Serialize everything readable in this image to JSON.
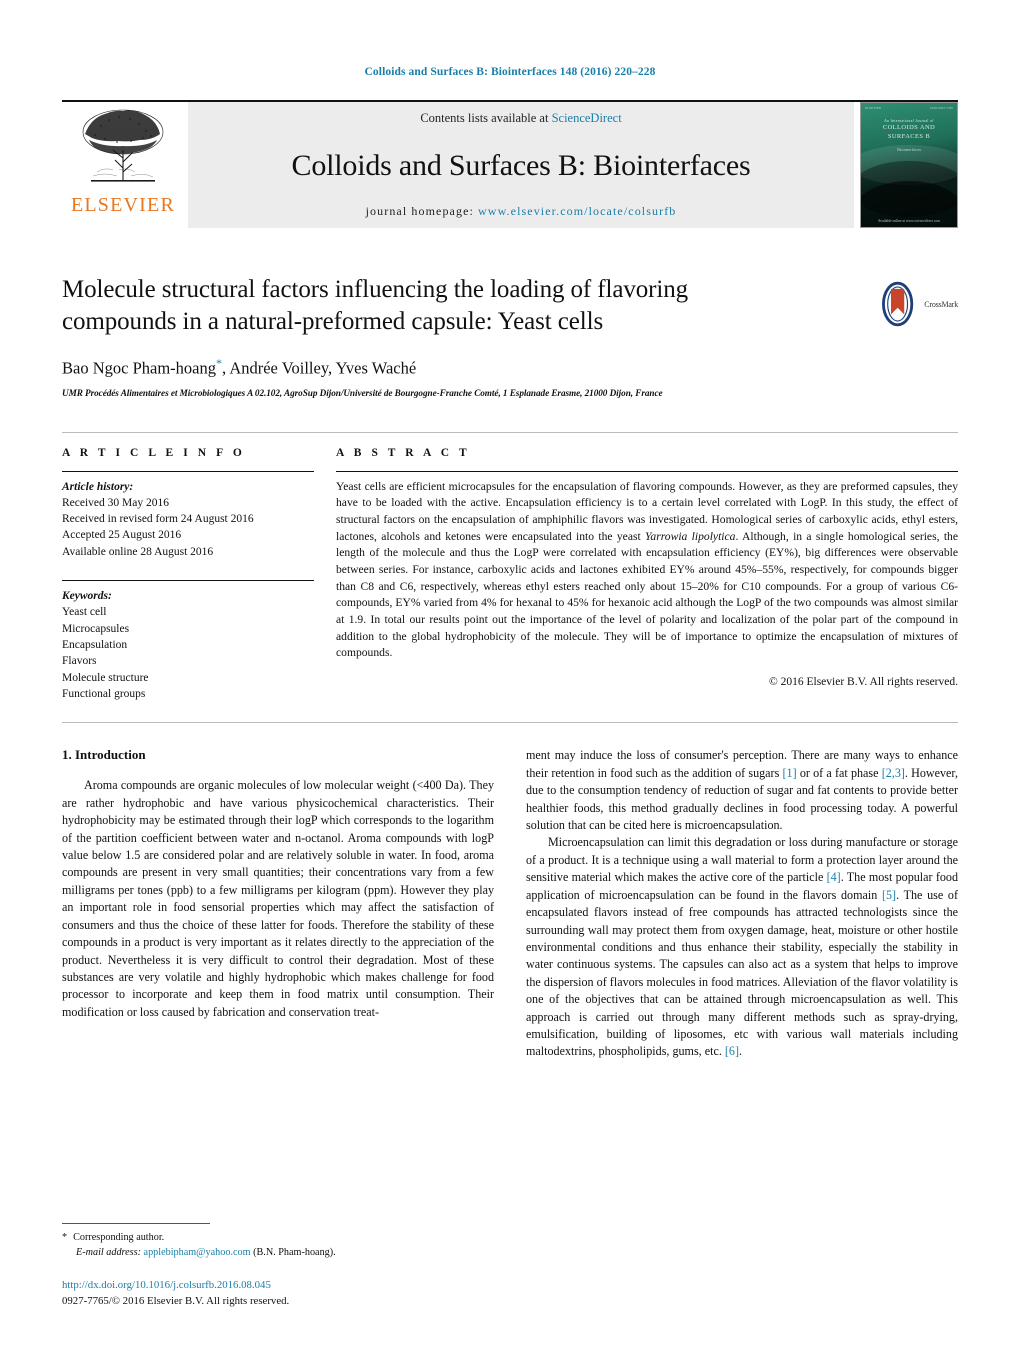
{
  "running_head": "Colloids and Surfaces B: Biointerfaces 148 (2016) 220–228",
  "masthead": {
    "contents_prefix": "Contents lists available at ",
    "sciencedirect": "ScienceDirect",
    "journal_title": "Colloids and Surfaces B: Biointerfaces",
    "homepage_prefix": "journal homepage: ",
    "homepage_url": "www.elsevier.com/locate/colsurfb",
    "publisher": "ELSEVIER",
    "cover": {
      "top_left": "ELSEVIER",
      "top_right": "ISSN 0927-7765",
      "eyebrow": "An International Journal of",
      "title_line1": "COLLOIDS AND",
      "title_line2": "SURFACES B",
      "subtitle": "Biointerfaces",
      "bottom": "Available online at www.sciencedirect.com"
    }
  },
  "article": {
    "title": "Molecule structural factors influencing the loading of flavoring compounds in a natural-preformed capsule: Yeast cells",
    "crossmark_label": "CrossMark",
    "authors": "Bao Ngoc Pham-hoang",
    "authors_rest": ", Andrée Voilley, Yves Waché",
    "corresponding_marker": "*",
    "affiliation": "UMR Procédés Alimentaires et Microbiologiques A 02.102, AgroSup Dijon/Université de Bourgogne-Franche Comté, 1 Esplanade Erasme, 21000 Dijon, France"
  },
  "article_info": {
    "heading": "A R T I C L E   I N F O",
    "history_label": "Article history:",
    "history": [
      "Received 30 May 2016",
      "Received in revised form 24 August 2016",
      "Accepted 25 August 2016",
      "Available online 28 August 2016"
    ],
    "keywords_label": "Keywords:",
    "keywords": [
      "Yeast cell",
      "Microcapsules",
      "Encapsulation",
      "Flavors",
      "Molecule structure",
      "Functional groups"
    ]
  },
  "abstract": {
    "heading": "A B S T R A C T",
    "part1": "Yeast cells are efficient microcapsules for the encapsulation of flavoring compounds. However, as they are preformed capsules, they have to be loaded with the active. Encapsulation efficiency is to a certain level correlated with LogP. In this study, the effect of structural factors on the encapsulation of amphiphilic flavors was investigated. Homological series of carboxylic acids, ethyl esters, lactones, alcohols and ketones were encapsulated into the yeast ",
    "italic_organism": "Yarrowia lipolytica",
    "part2": ". Although, in a single homological series, the length of the molecule and thus the LogP were correlated with encapsulation efficiency (EY%), big differences were observable between series. For instance, carboxylic acids and lactones exhibited EY% around 45%–55%, respectively, for compounds bigger than C8 and C6, respectively, whereas ethyl esters reached only about 15–20% for C10 compounds. For a group of various C6-compounds, EY% varied from 4% for hexanal to 45% for hexanoic acid although the LogP of the two compounds was almost similar at 1.9. In total our results point out the importance of the level of polarity and localization of the polar part of the compound in addition to the global hydrophobicity of the molecule. They will be of importance to optimize the encapsulation of mixtures of compounds.",
    "copyright": "© 2016 Elsevier B.V. All rights reserved."
  },
  "body": {
    "section_heading": "1. Introduction",
    "left_paragraph_1": "Aroma compounds are organic molecules of low molecular weight (<400 Da). They are rather hydrophobic and have various physicochemical characteristics. Their hydrophobicity may be estimated through their logP which corresponds to the logarithm of the partition coefficient between water and n-octanol. Aroma compounds with logP value below 1.5 are considered polar and are relatively soluble in water. In food, aroma compounds are present in very small quantities; their concentrations vary from a few milligrams per tones (ppb) to a few milligrams per kilogram (ppm). However they play an important role in food sensorial properties which may affect the satisfaction of consumers and thus the choice of these latter for foods. Therefore the stability of these compounds in a product is very important as it relates directly to the appreciation of the product. Nevertheless it is very difficult to control their degradation. Most of these substances are very volatile and highly hydrophobic which makes challenge for food processor to incorporate and keep them in food matrix until consumption. Their modification or loss caused by fabrication and conservation treat-",
    "right_paragraph_1a": "ment may induce the loss of consumer's perception. There are many ways to enhance their retention in food such as the addition of sugars ",
    "right_ref_1": "[1]",
    "right_paragraph_1b": " or of a fat phase ",
    "right_ref_23": "[2,3]",
    "right_paragraph_1c": ". However, due to the consumption tendency of reduction of sugar and fat contents to provide better healthier foods, this method gradually declines in food processing today. A powerful solution that can be cited here is microencapsulation.",
    "right_paragraph_2a": "Microencapsulation can limit this degradation or loss during manufacture or storage of a product. It is a technique using a wall material to form a protection layer around the sensitive material which makes the active core of the particle ",
    "right_ref_4": "[4]",
    "right_paragraph_2b": ". The most popular food application of microencapsulation can be found in the flavors domain ",
    "right_ref_5": "[5]",
    "right_paragraph_2c": ". The use of encapsulated flavors instead of free compounds has attracted technologists since the surrounding wall may protect them from oxygen damage, heat, moisture or other hostile environmental conditions and thus enhance their stability, especially the stability in water continuous systems. The capsules can also act as a system that helps to improve the dispersion of flavors molecules in food matrices. Alleviation of the flavor volatility is one of the objectives that can be attained through microencapsulation as well. This approach is carried out through many different methods such as spray-drying, emulsification, building of liposomes, etc with various wall materials including maltodextrins, phospholipids, gums, etc. ",
    "right_ref_6": "[6]",
    "right_paragraph_2d": "."
  },
  "footer": {
    "corresponding_star": "*",
    "corresponding_text": "Corresponding author.",
    "email_label": "E-mail address:",
    "email": "applebipham@yahoo.com",
    "email_owner": "(B.N. Pham-hoang).",
    "doi": "http://dx.doi.org/10.1016/j.colsurfb.2016.08.045",
    "issn": "0927-7765/© 2016 Elsevier B.V. All rights reserved."
  },
  "colors": {
    "link": "#1a7fa8",
    "elsevier_orange": "#E87722",
    "masthead_bg": "#ececec"
  }
}
